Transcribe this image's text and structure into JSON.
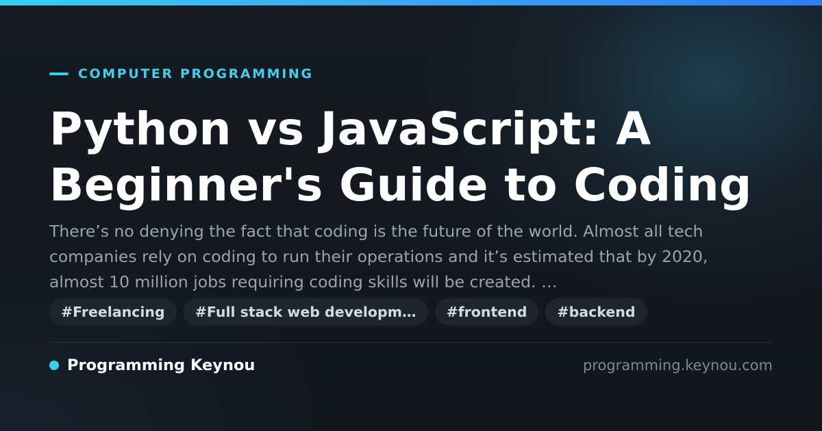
{
  "category": {
    "label": "COMPUTER PROGRAMMING"
  },
  "article": {
    "title_line1": "Python vs JavaScript: A",
    "title_line2": "Beginner's Guide to Coding",
    "description": "There’s no denying the fact that coding is the future of the world. Almost all tech companies rely on coding to run their operations and it’s estimated that by 2020, almost 10 million jobs requiring coding skills will be created. …"
  },
  "tags": [
    "#Freelancing",
    "#Full stack web developm…",
    "#frontend",
    "#backend"
  ],
  "footer": {
    "brand": "Programming Keynou",
    "url": "programming.keynou.com"
  },
  "colors": {
    "accent": "#38d0ef",
    "background": "#131821",
    "title": "#ffffff",
    "description": "#9aa4b1",
    "tag_background": "#1d2531"
  }
}
